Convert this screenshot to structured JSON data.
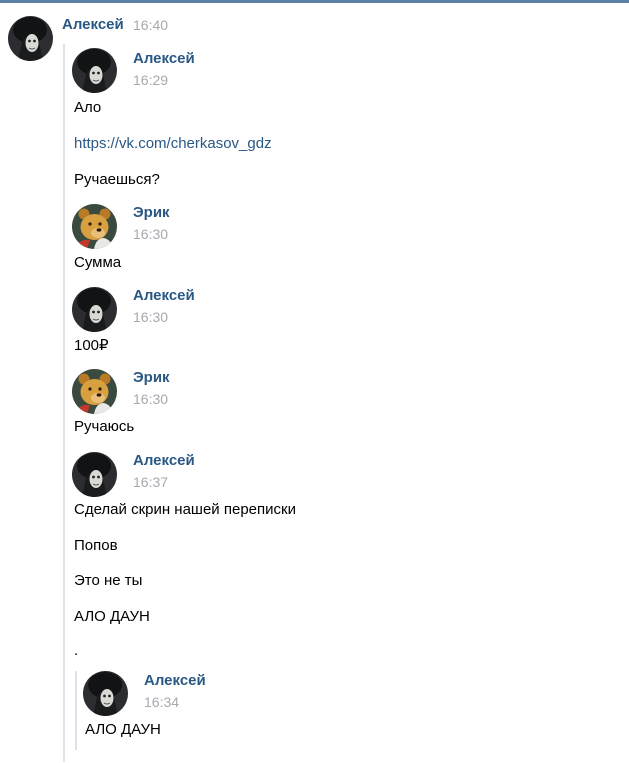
{
  "outer": {
    "author": "Алексей",
    "time": "16:40"
  },
  "forwarded": [
    {
      "author": "Алексей",
      "time": "16:29",
      "avatar": "alexey",
      "lines": [
        "Ало",
        "https://vk.com/cherkasov_gdz",
        "Ручаешься?"
      ]
    },
    {
      "author": "Эрик",
      "time": "16:30",
      "avatar": "erik",
      "lines": [
        "Сумма"
      ]
    },
    {
      "author": "Алексей",
      "time": "16:30",
      "avatar": "alexey",
      "lines": [
        "100₽"
      ]
    },
    {
      "author": "Эрик",
      "time": "16:30",
      "avatar": "erik",
      "lines": [
        "Ручаюсь"
      ]
    },
    {
      "author": "Алексей",
      "time": "16:37",
      "avatar": "alexey",
      "lines": [
        "Сделай скрин нашей переписки",
        "Попов",
        "Это не ты",
        "АЛО ДАУН",
        "."
      ]
    }
  ],
  "nested": {
    "author": "Алексей",
    "time": "16:34",
    "lines": [
      "АЛО ДАУН"
    ]
  },
  "colors": {
    "author": "#2a5885",
    "time": "#a5a9ae",
    "accent_bar": "#5b7fa6",
    "quote_bar": "#dfe3e8"
  }
}
